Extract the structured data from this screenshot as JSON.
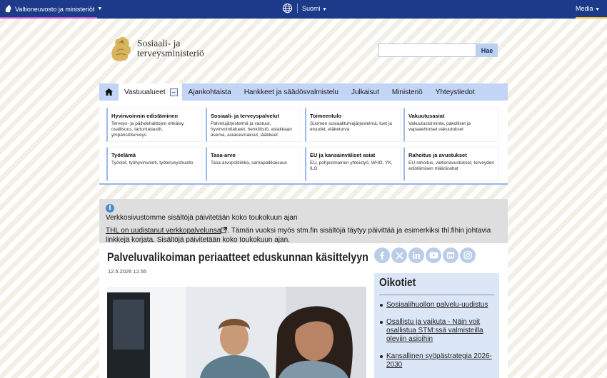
{
  "topbar": {
    "site": "Valtioneuvosto ja ministeriöt",
    "language": "Suomi",
    "media": "Media"
  },
  "header": {
    "logo_line1": "Sosiaali- ja",
    "logo_line2": "terveysministeriö",
    "search_placeholder": "",
    "search_button": "Hae"
  },
  "nav": {
    "items": [
      "Vastuualueet",
      "Ajankohtaista",
      "Hankkeet ja säädösvalmistelu",
      "Julkaisut",
      "Ministeriö",
      "Yhteystiedot"
    ],
    "collapse_symbol": "–"
  },
  "dropdown": {
    "cards": [
      {
        "title": "Hyvinvoinnin edistäminen",
        "desc": "Terveys- ja päihdehaittojen ehkäisy, osallisuus, tartuntataudit, ympäristöterveys"
      },
      {
        "title": "Sosiaali- ja terveyspalvelut",
        "desc": "Palvelujärjestelmä ja vastuut, hyvinvointialueet, henkilöstö, asiakkaan asema, asiakasmaksut, lääkkeet"
      },
      {
        "title": "Toimeentulo",
        "desc": "Suomen sosiaaliturvajärjestelmä, tuet ja etuudet, eläketurva"
      },
      {
        "title": "Vakuutusasiat",
        "desc": "Vakuutustoiminta, pakolliset ja vapaaehtoiset vakuutukset"
      },
      {
        "title": "Työelämä",
        "desc": "Työolot, työhyvinvointi, työterveyshuolto"
      },
      {
        "title": "Tasa-arvo",
        "desc": "Tasa-arvopolitiikka, samapalkkaisuus"
      },
      {
        "title": "EU ja kansainväliset asiat",
        "desc": "EU, pohjoismainen yhteistyö, WHO, YK, ILO"
      },
      {
        "title": "Rahoitus ja avustukset",
        "desc": "EU-rahoitus, valtionavustukset, terveyden edistämisen määrärahat"
      }
    ]
  },
  "notice": {
    "line1": "Verkkosivustomme sisältöjä päivitetään koko toukokuun ajan",
    "link": "THL on uudistanut verkkopalvelunsa",
    "rest": ". Tämän vuoksi myös stm.fin sisältöjä täytyy päivittää ja esimerkiksi thl.fihin johtavia linkkejä korjata. Sisältöjä päivitetään koko toukokuun ajan."
  },
  "article": {
    "title": "Palveluvalikoiman periaatteet eduskunnan käsittelyyn",
    "date": "12.5.2026 12.55"
  },
  "social": [
    "facebook-icon",
    "x-icon",
    "linkedin-icon",
    "youtube-icon",
    "flickr-icon",
    "instagram-icon"
  ],
  "oikotiet": {
    "title": "Oikotiet",
    "links": [
      "Sosiaalihuollon palvelu-uudistus",
      "Osallistu ja vaikuta - Näin voit osallistua STM:ssä valmisteilla oleviin asioihin",
      "Kansallinen syöpästrategia 2026-2030"
    ]
  },
  "colors": {
    "topbar": "#1d3a8a",
    "nav": "#c2d5f6",
    "accent_pink": "#c45ac9",
    "accent_yellow": "#f3c23a",
    "lion_gold": "#c9a24a"
  }
}
